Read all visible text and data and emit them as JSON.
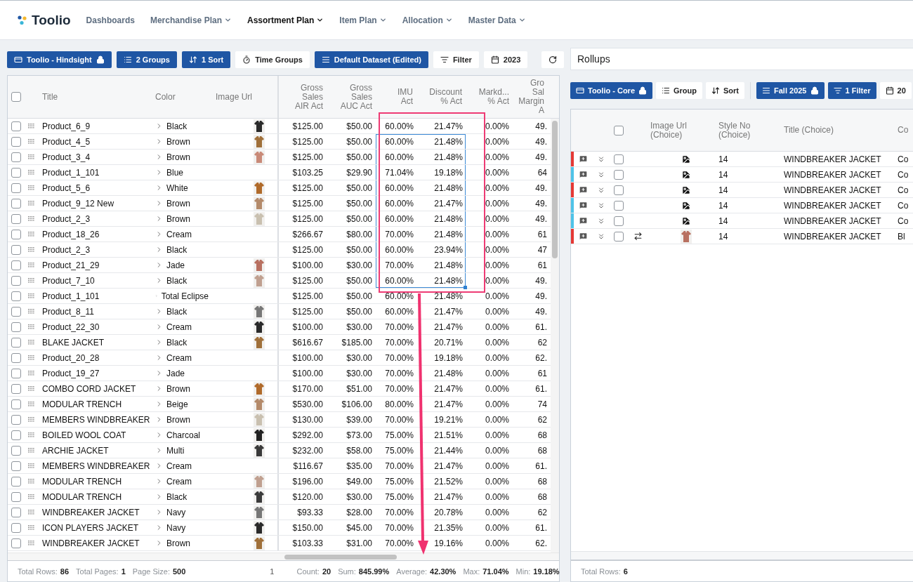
{
  "nav": {
    "logo": "Toolio",
    "items": [
      {
        "label": "Dashboards",
        "selected": false,
        "dropdown": false
      },
      {
        "label": "Merchandise Plan",
        "selected": false,
        "dropdown": true
      },
      {
        "label": "Assortment Plan",
        "selected": true,
        "dropdown": true
      },
      {
        "label": "Item Plan",
        "selected": false,
        "dropdown": true
      },
      {
        "label": "Allocation",
        "selected": false,
        "dropdown": true
      },
      {
        "label": "Master Data",
        "selected": false,
        "dropdown": true
      }
    ]
  },
  "left": {
    "toolbar": [
      {
        "label": "Toolio - Hindsight",
        "primary": true,
        "locked": true
      },
      {
        "label": "2 Groups",
        "primary": true,
        "locked": false
      },
      {
        "label": "1 Sort",
        "primary": true,
        "locked": false
      },
      {
        "label": "Time Groups",
        "primary": false,
        "locked": false
      },
      {
        "label": "Default Dataset (Edited)",
        "primary": true,
        "locked": false
      },
      {
        "label": "Filter",
        "primary": false,
        "locked": false
      },
      {
        "label": "2023",
        "primary": false,
        "locked": false
      }
    ],
    "select_all_checked": false,
    "columns": [
      "Title",
      "Color",
      "Image Url",
      "Gross\nSales\nAIR Act",
      "Gross\nSales\nAUC Act",
      "IMU\nAct",
      "Discount\n% Act",
      "Markd...\n% Act",
      "Gro\nSal\nMargin\nA"
    ],
    "rows": [
      {
        "checked": false,
        "title": "Product_6_9",
        "color_name": "Black",
        "image": true,
        "air": "$125.00",
        "auc": "$50.00",
        "imu": "60.00%",
        "discount": "21.47%",
        "markdown": "0.00%",
        "column_11": "49.",
        "range_selected": false
      },
      {
        "checked": false,
        "title": "Product_4_5",
        "color_name": "Brown",
        "image": true,
        "air": "$125.00",
        "auc": "$50.00",
        "imu": "60.00%",
        "discount": "21.48%",
        "markdown": "0.00%",
        "column_11": "49.",
        "range_selected": true
      },
      {
        "checked": false,
        "title": "Product_3_4",
        "color_name": "Brown",
        "image": true,
        "air": "$125.00",
        "auc": "$50.00",
        "imu": "60.00%",
        "discount": "21.48%",
        "markdown": "0.00%",
        "column_11": "49.",
        "range_selected": true
      },
      {
        "checked": false,
        "title": "Product_1_101",
        "color_name": "Blue",
        "image": false,
        "air": "$103.25",
        "auc": "$29.90",
        "imu": "71.04%",
        "discount": "19.18%",
        "markdown": "0.00%",
        "column_11": "64",
        "range_selected": true
      },
      {
        "checked": false,
        "title": "Product_5_6",
        "color_name": "White",
        "image": true,
        "air": "$125.00",
        "auc": "$50.00",
        "imu": "60.00%",
        "discount": "21.48%",
        "markdown": "0.00%",
        "column_11": "49.",
        "range_selected": true
      },
      {
        "checked": false,
        "title": "Product_9_12 New",
        "color_name": "Brown",
        "image": true,
        "air": "$125.00",
        "auc": "$50.00",
        "imu": "60.00%",
        "discount": "21.47%",
        "markdown": "0.00%",
        "column_11": "49.",
        "range_selected": true
      },
      {
        "checked": false,
        "title": "Product_2_3",
        "color_name": "Brown",
        "image": true,
        "air": "$125.00",
        "auc": "$50.00",
        "imu": "60.00%",
        "discount": "21.48%",
        "markdown": "0.00%",
        "column_11": "49.",
        "range_selected": true
      },
      {
        "checked": false,
        "title": "Product_18_26",
        "color_name": "Cream",
        "image": false,
        "air": "$266.67",
        "auc": "$80.00",
        "imu": "70.00%",
        "discount": "21.48%",
        "markdown": "0.00%",
        "column_11": "61",
        "range_selected": true
      },
      {
        "checked": false,
        "title": "Product_2_3",
        "color_name": "Black",
        "image": false,
        "air": "$125.00",
        "auc": "$50.00",
        "imu": "60.00%",
        "discount": "23.94%",
        "markdown": "0.00%",
        "column_11": "47",
        "range_selected": true
      },
      {
        "checked": false,
        "title": "Product_21_29",
        "color_name": "Jade",
        "image": true,
        "air": "$100.00",
        "auc": "$30.00",
        "imu": "70.00%",
        "discount": "21.48%",
        "markdown": "0.00%",
        "column_11": "61",
        "range_selected": true
      },
      {
        "checked": false,
        "title": "Product_7_10",
        "color_name": "Black",
        "image": true,
        "air": "$125.00",
        "auc": "$50.00",
        "imu": "60.00%",
        "discount": "21.48%",
        "markdown": "0.00%",
        "column_11": "49.",
        "range_selected": true
      },
      {
        "checked": false,
        "title": "Product_1_101",
        "color_name": "Total Eclipse",
        "image": false,
        "air": "$125.00",
        "auc": "$50.00",
        "imu": "60.00%",
        "discount": "21.48%",
        "markdown": "0.00%",
        "column_11": "49.",
        "range_selected": false
      },
      {
        "checked": false,
        "title": "Product_8_11",
        "color_name": "Black",
        "image": true,
        "air": "$125.00",
        "auc": "$50.00",
        "imu": "60.00%",
        "discount": "21.47%",
        "markdown": "0.00%",
        "column_11": "49.",
        "range_selected": false
      },
      {
        "checked": false,
        "title": "Product_22_30",
        "color_name": "Cream",
        "image": true,
        "air": "$100.00",
        "auc": "$30.00",
        "imu": "70.00%",
        "discount": "21.47%",
        "markdown": "0.00%",
        "column_11": "61.",
        "range_selected": false
      },
      {
        "checked": false,
        "title": "BLAKE JACKET",
        "color_name": "Black",
        "image": true,
        "air": "$616.67",
        "auc": "$185.00",
        "imu": "70.00%",
        "discount": "20.71%",
        "markdown": "0.00%",
        "column_11": "62",
        "range_selected": false
      },
      {
        "checked": false,
        "title": "Product_20_28",
        "color_name": "Cream",
        "image": false,
        "air": "$100.00",
        "auc": "$30.00",
        "imu": "70.00%",
        "discount": "19.18%",
        "markdown": "0.00%",
        "column_11": "62.",
        "range_selected": false
      },
      {
        "checked": false,
        "title": "Product_19_27",
        "color_name": "Jade",
        "image": false,
        "air": "$100.00",
        "auc": "$30.00",
        "imu": "70.00%",
        "discount": "21.48%",
        "markdown": "0.00%",
        "column_11": "61",
        "range_selected": false
      },
      {
        "checked": false,
        "title": "COMBO CORD JACKET",
        "color_name": "Brown",
        "image": true,
        "air": "$170.00",
        "auc": "$51.00",
        "imu": "70.00%",
        "discount": "21.47%",
        "markdown": "0.00%",
        "column_11": "61.",
        "range_selected": false
      },
      {
        "checked": false,
        "title": "MODULAR TRENCH",
        "color_name": "Beige",
        "image": true,
        "air": "$530.00",
        "auc": "$106.00",
        "imu": "80.00%",
        "discount": "21.47%",
        "markdown": "0.00%",
        "column_11": "74",
        "range_selected": false
      },
      {
        "checked": false,
        "title": "MEMBERS WINDBREAKER",
        "color_name": "Brown",
        "image": true,
        "air": "$130.00",
        "auc": "$39.00",
        "imu": "70.00%",
        "discount": "19.21%",
        "markdown": "0.00%",
        "column_11": "62",
        "range_selected": false
      },
      {
        "checked": false,
        "title": "BOILED WOOL COAT",
        "color_name": "Charcoal",
        "image": true,
        "air": "$292.00",
        "auc": "$73.00",
        "imu": "75.00%",
        "discount": "21.51%",
        "markdown": "0.00%",
        "column_11": "68",
        "range_selected": false
      },
      {
        "checked": false,
        "title": "ARCHIE JACKET",
        "color_name": "Multi",
        "image": true,
        "air": "$232.00",
        "auc": "$58.00",
        "imu": "75.00%",
        "discount": "21.44%",
        "markdown": "0.00%",
        "column_11": "68",
        "range_selected": false
      },
      {
        "checked": false,
        "title": "MEMBERS WINDBREAKER",
        "color_name": "Cream",
        "image": false,
        "air": "$116.67",
        "auc": "$35.00",
        "imu": "70.00%",
        "discount": "21.47%",
        "markdown": "0.00%",
        "column_11": "61.",
        "range_selected": false
      },
      {
        "checked": false,
        "title": "MODULAR TRENCH",
        "color_name": "Cream",
        "image": true,
        "air": "$196.00",
        "auc": "$49.00",
        "imu": "75.00%",
        "discount": "21.52%",
        "markdown": "0.00%",
        "column_11": "68",
        "range_selected": false
      },
      {
        "checked": false,
        "title": "MODULAR TRENCH",
        "color_name": "Black",
        "image": true,
        "air": "$120.00",
        "auc": "$30.00",
        "imu": "75.00%",
        "discount": "21.47%",
        "markdown": "0.00%",
        "column_11": "68",
        "range_selected": false
      },
      {
        "checked": false,
        "title": "WINDBREAKER JACKET",
        "color_name": "Navy",
        "image": true,
        "air": "$93.33",
        "auc": "$28.00",
        "imu": "70.00%",
        "discount": "20.78%",
        "markdown": "0.00%",
        "column_11": "62",
        "range_selected": false
      },
      {
        "checked": false,
        "title": "ICON PLAYERS JACKET",
        "color_name": "Navy",
        "image": true,
        "air": "$150.00",
        "auc": "$45.00",
        "imu": "70.00%",
        "discount": "21.35%",
        "markdown": "0.00%",
        "column_11": "61.",
        "range_selected": false
      },
      {
        "checked": false,
        "title": "WINDBREAKER JACKET",
        "color_name": "Brown",
        "image": true,
        "air": "$103.33",
        "auc": "$31.00",
        "imu": "70.00%",
        "discount": "19.16%",
        "markdown": "0.00%",
        "column_11": "62.",
        "range_selected": false
      }
    ],
    "footer": {
      "totals": [
        {
          "label": "Total Rows:",
          "value": "86"
        },
        {
          "label": "Total Pages:",
          "value": "1"
        },
        {
          "label": "Page Size:",
          "value": "500"
        }
      ],
      "page": "1",
      "stats": [
        {
          "label": "Count:",
          "value": "20"
        },
        {
          "label": "Sum:",
          "value": "845.99%"
        },
        {
          "label": "Average:",
          "value": "42.30%"
        },
        {
          "label": "Max:",
          "value": "71.04%"
        },
        {
          "label": "Min:",
          "value": "19.18%"
        }
      ]
    }
  },
  "right": {
    "view_field": {
      "value": "Rollups"
    },
    "toolbar_groups": [
      [
        {
          "label": "Toolio - Core",
          "primary": true,
          "locked": true
        },
        {
          "label": "Group",
          "primary": false,
          "locked": false
        },
        {
          "label": "Sort",
          "primary": false,
          "locked": false
        }
      ],
      [
        {
          "label": "Fall 2025",
          "primary": true,
          "locked": true
        },
        {
          "label": "1 Filter",
          "primary": true,
          "locked": false
        },
        {
          "label": "20",
          "primary": false,
          "locked": false
        }
      ]
    ],
    "select_all_checked": false,
    "columns": [
      "Image Url\n(Choice)",
      "Style No\n(Choice)",
      "Title (Choice)",
      "Co"
    ],
    "rows": [
      {
        "color": "#e53935",
        "checked": false,
        "swap": false,
        "image": false,
        "style_no": "14",
        "title": "WINDBREAKER JACKET",
        "column_4": "Co"
      },
      {
        "color": "#4fc3e8",
        "checked": false,
        "swap": false,
        "image": false,
        "style_no": "14",
        "title": "WINDBREAKER JACKET",
        "column_4": "Co"
      },
      {
        "color": "#e53935",
        "checked": false,
        "swap": false,
        "image": false,
        "style_no": "14",
        "title": "WINDBREAKER JACKET",
        "column_4": "Co"
      },
      {
        "color": "#4fc3e8",
        "checked": false,
        "swap": false,
        "image": false,
        "style_no": "14",
        "title": "WINDBREAKER JACKET",
        "column_4": "Co"
      },
      {
        "color": "#4fc3e8",
        "checked": false,
        "swap": false,
        "image": false,
        "style_no": "14",
        "title": "WINDBREAKER JACKET",
        "column_4": "Co"
      },
      {
        "color": "#e53935",
        "checked": false,
        "swap": true,
        "image": true,
        "style_no": "14",
        "title": "WINDBREAKER JACKET",
        "column_4": "Bl"
      }
    ],
    "footer": {
      "label": "Total Rows:",
      "value": "6"
    }
  }
}
